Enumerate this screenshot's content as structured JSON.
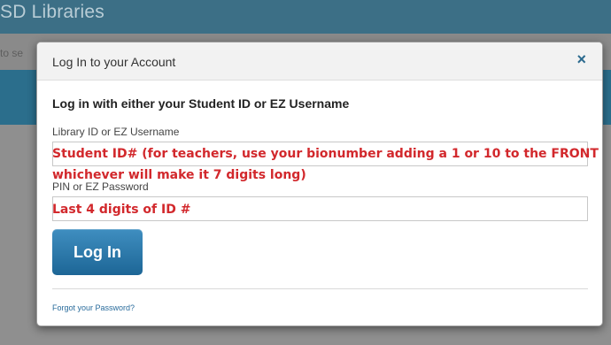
{
  "background": {
    "title_fragment": "SD Libraries",
    "search_hint_fragment": "to se"
  },
  "modal": {
    "title": "Log In to your Account",
    "close_glyph": "×",
    "heading": "Log in with either your Student ID or EZ Username",
    "id_label": "Library ID or EZ Username",
    "pin_label": "PIN or EZ Password",
    "login_button": "Log In",
    "forgot_link": "Forgot your Password?"
  },
  "annotations": {
    "id_line1": "Student ID# (for teachers, use your bionumber adding a 1 or 10 to the FRONT",
    "id_line2": "whichever will make it 7 digits long)",
    "pin": "Last 4 digits of ID #"
  },
  "colors": {
    "annotation": "#d2282c",
    "button": "#1d6696",
    "link": "#2a6c9c"
  }
}
